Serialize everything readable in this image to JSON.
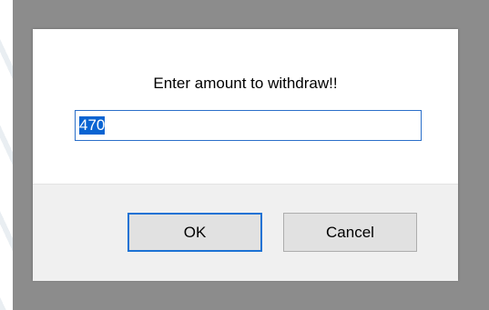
{
  "dialog": {
    "message": "Enter amount to withdraw!!",
    "input_value": "470",
    "ok_label": "OK",
    "cancel_label": "Cancel"
  },
  "colors": {
    "focus_border": "#1d72d4",
    "selection": "#0a64d2",
    "footer_bg": "#f0f0f0",
    "overlay": "#8c8c8c"
  }
}
